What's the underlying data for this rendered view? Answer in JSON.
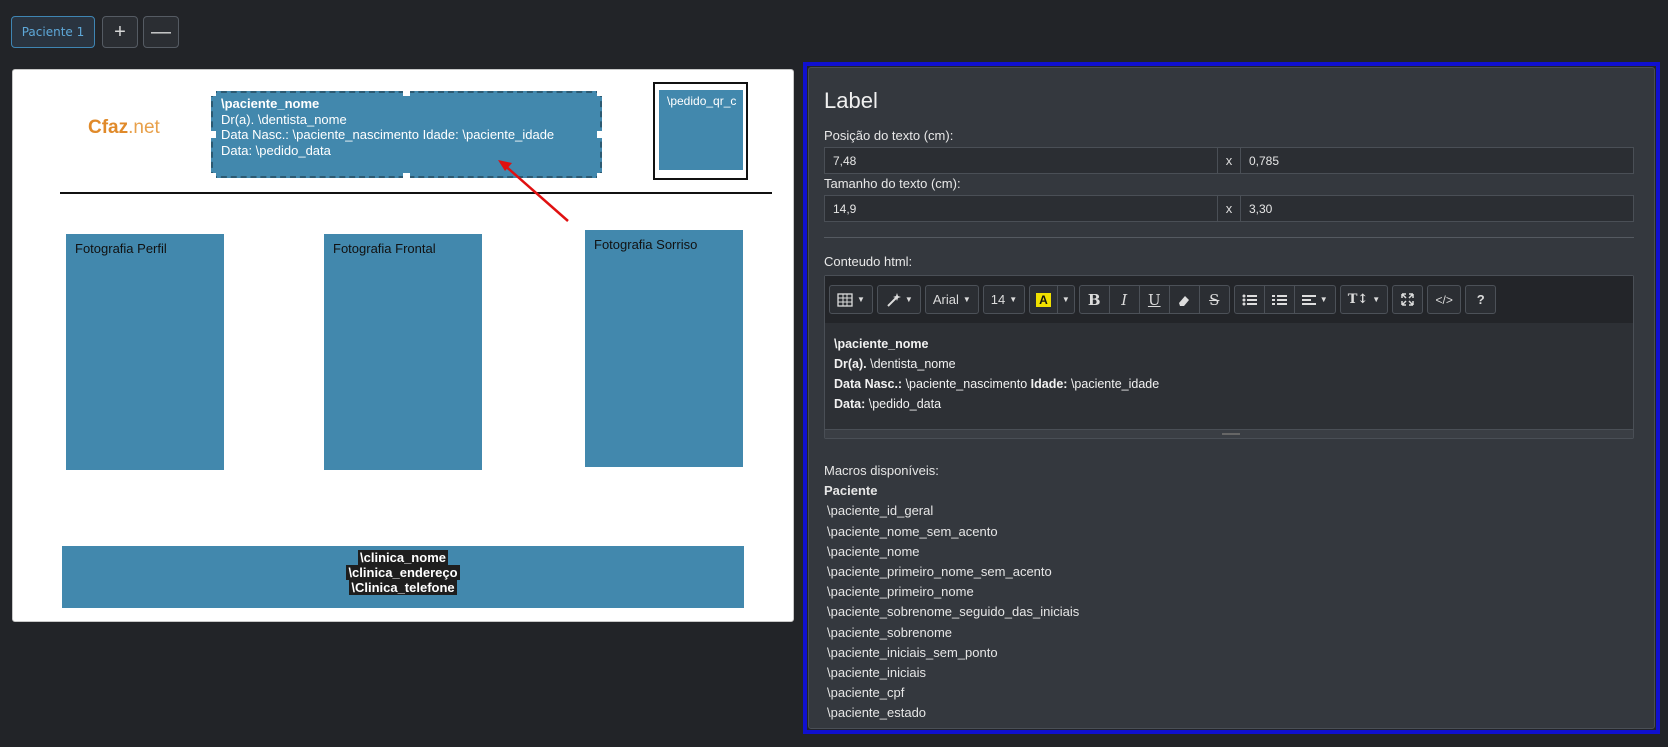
{
  "tabs": {
    "patient_tab": "Paciente 1",
    "add_symbol": "+",
    "remove_symbol": "—"
  },
  "canvas": {
    "logo_main": "Cfaz",
    "logo_suffix": ".net",
    "label_lines": [
      "\\paciente_nome",
      "Dr(a). \\dentista_nome",
      "Data Nasc.: \\paciente_nascimento Idade: \\paciente_idade",
      "Data: \\pedido_data"
    ],
    "qr_text": "\\pedido_qr_c",
    "photos": [
      "Fotografia Perfil",
      "Fotografia Frontal",
      "Fotografia Sorriso"
    ],
    "footer_lines": [
      "\\clinica_nome",
      "\\clinica_endereço",
      "\\Clinica_telefone"
    ]
  },
  "panel": {
    "title": "Label",
    "position_label": "Posição do texto (cm):",
    "position_x": "7,48",
    "position_y": "0,785",
    "size_label": "Tamanho do texto (cm):",
    "size_w": "14,9",
    "size_h": "3,30",
    "separator": "x",
    "html_label": "Conteudo html:",
    "toolbar": {
      "font_name": "Arial",
      "font_size": "14"
    },
    "editor_lines": [
      {
        "bold": "\\paciente_nome",
        "rest": ""
      },
      {
        "bold": "Dr(a).",
        "rest": " \\dentista_nome"
      },
      {
        "bold": "Data Nasc.:",
        "rest": " \\paciente_nascimento ",
        "bold2": "Idade:",
        "rest2": " \\paciente_idade"
      },
      {
        "bold": "Data:",
        "rest": " \\pedido_data"
      }
    ],
    "macros_title": "Macros disponíveis:",
    "macros_group": "Paciente",
    "macros": [
      "\\paciente_id_geral",
      "\\paciente_nome_sem_acento",
      "\\paciente_nome",
      "\\paciente_primeiro_nome_sem_acento",
      "\\paciente_primeiro_nome",
      "\\paciente_sobrenome_seguido_das_iniciais",
      "\\paciente_sobrenome",
      "\\paciente_iniciais_sem_ponto",
      "\\paciente_iniciais",
      "\\paciente_cpf",
      "\\paciente_estado"
    ]
  }
}
